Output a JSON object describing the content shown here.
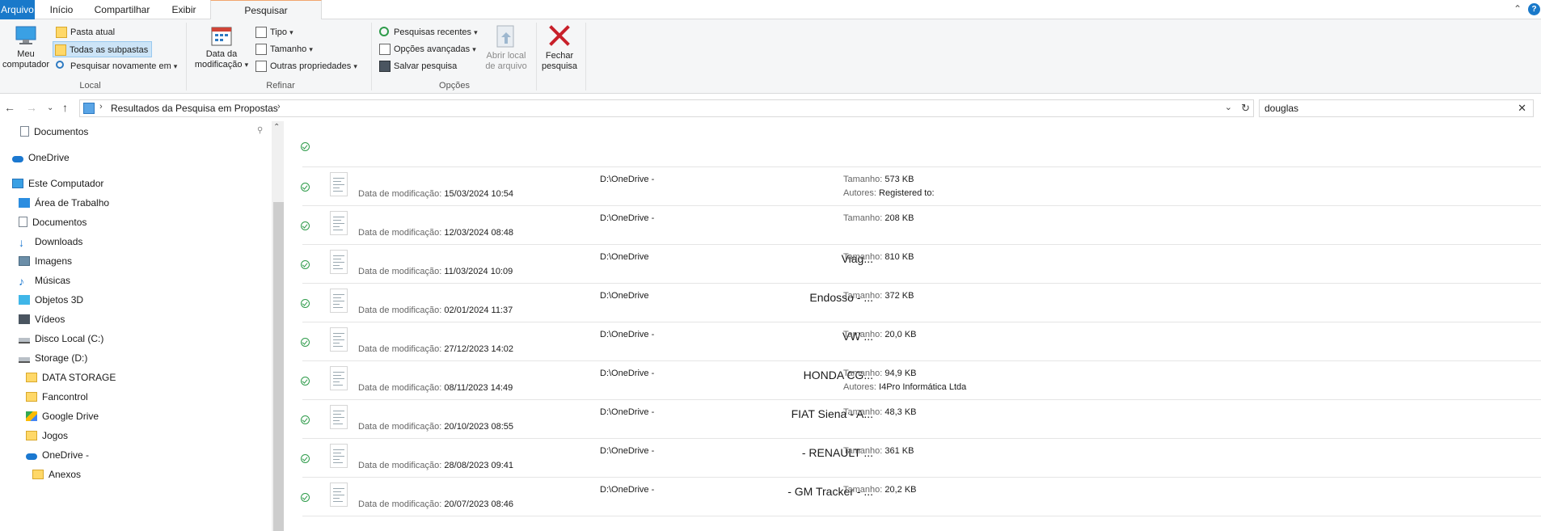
{
  "ribbon": {
    "tabs": {
      "file": "Arquivo",
      "home": "Início",
      "share": "Compartilhar",
      "view": "Exibir",
      "search": "Pesquisar"
    },
    "local": {
      "my_computer_1": "Meu",
      "my_computer_2": "computador",
      "current_folder": "Pasta atual",
      "all_subfolders": "Todas as subpastas",
      "search_again": "Pesquisar novamente em",
      "group": "Local"
    },
    "refine": {
      "date_1": "Data da",
      "date_2": "modificação",
      "type": "Tipo",
      "size": "Tamanho",
      "other": "Outras propriedades",
      "group": "Refinar"
    },
    "options": {
      "recent": "Pesquisas recentes",
      "advanced": "Opções avançadas",
      "save": "Salvar pesquisa",
      "open_location_1": "Abrir local",
      "open_location_2": "de arquivo",
      "close_1": "Fechar",
      "close_2": "pesquisa",
      "group": "Opções"
    }
  },
  "address": {
    "path": "Resultados da Pesquisa em Propostas",
    "search_value": "douglas"
  },
  "nav": {
    "items": [
      {
        "label": "Documentos",
        "icon": "document-icon"
      },
      {
        "label": "OneDrive",
        "icon": "cloud-icon"
      },
      {
        "label": "Este Computador",
        "icon": "computer-icon"
      },
      {
        "label": "Área de Trabalho",
        "icon": "desktop-icon"
      },
      {
        "label": "Documentos",
        "icon": "document-icon"
      },
      {
        "label": "Downloads",
        "icon": "download-icon"
      },
      {
        "label": "Imagens",
        "icon": "image-icon"
      },
      {
        "label": "Músicas",
        "icon": "music-icon"
      },
      {
        "label": "Objetos 3D",
        "icon": "cube-icon"
      },
      {
        "label": "Vídeos",
        "icon": "video-icon"
      },
      {
        "label": "Disco Local (C:)",
        "icon": "drive-icon"
      },
      {
        "label": "Storage (D:)",
        "icon": "drive-icon"
      },
      {
        "label": "DATA STORAGE",
        "icon": "folder-icon"
      },
      {
        "label": "Fancontrol",
        "icon": "folder-icon"
      },
      {
        "label": "Google Drive",
        "icon": "google-drive-icon"
      },
      {
        "label": "Jogos",
        "icon": "folder-icon"
      },
      {
        "label": "OneDrive -",
        "icon": "cloud-icon"
      },
      {
        "label": "Anexos",
        "icon": "folder-icon"
      }
    ]
  },
  "labels": {
    "modified": "Data de modificação:",
    "size": "Tamanho:",
    "authors": "Autores:"
  },
  "results": [
    {
      "name": "",
      "modified": "15/03/2024 10:54",
      "location": "D:\\OneDrive -",
      "size": "573 KB",
      "authors": "Registered to:"
    },
    {
      "name": "",
      "modified": "12/03/2024 08:48",
      "location": "D:\\OneDrive -",
      "size": "208 KB",
      "authors": ""
    },
    {
      "name": "Viag...",
      "modified": "11/03/2024 10:09",
      "location": "D:\\OneDrive",
      "size": "810 KB",
      "authors": ""
    },
    {
      "name": "Endosso - ...",
      "modified": "02/01/2024 11:37",
      "location": "D:\\OneDrive",
      "size": "372 KB",
      "authors": ""
    },
    {
      "name": "VW ...",
      "modified": "27/12/2023 14:02",
      "location": "D:\\OneDrive -",
      "size": "20,0 KB",
      "authors": ""
    },
    {
      "name": "HONDA CG...",
      "modified": "08/11/2023 14:49",
      "location": "D:\\OneDrive -",
      "size": "94,9 KB",
      "authors": "I4Pro Informática Ltda"
    },
    {
      "name": "FIAT Siena - A...",
      "modified": "20/10/2023 08:55",
      "location": "D:\\OneDrive -",
      "size": "48,3 KB",
      "authors": ""
    },
    {
      "name": "- RENAULT ...",
      "modified": "28/08/2023 09:41",
      "location": "D:\\OneDrive -",
      "size": "361 KB",
      "authors": ""
    },
    {
      "name": "- GM Tracker - ...",
      "modified": "20/07/2023 08:46",
      "location": "D:\\OneDrive -",
      "size": "20,2 KB",
      "authors": ""
    }
  ]
}
